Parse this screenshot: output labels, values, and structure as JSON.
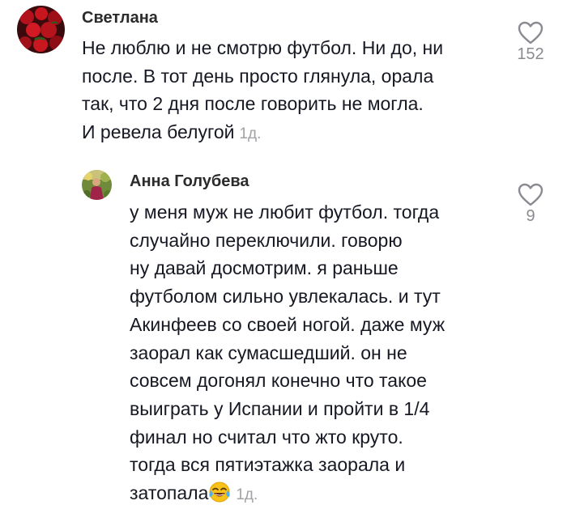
{
  "comments": [
    {
      "username": "Светлана",
      "avatar_icon": "roses-photo-avatar",
      "lines": [
        "Не люблю и не смотрю футбол. Ни до, ни",
        "после. В тот день просто глянула, орала",
        "так, что 2 дня после говорить не могла.",
        "И ревела белугой"
      ],
      "timestamp": "1д.",
      "like_icon": "heart-outline-icon",
      "likes": "152"
    },
    {
      "username": "Анна Голубева",
      "avatar_icon": "garden-photo-avatar",
      "lines": [
        "у меня муж не любит футбол. тогда",
        "случайно переключили. говорю",
        "ну давай досмотрим. я раньше",
        "футболом сильно увлекалась. и тут",
        "Акинфеев со своей ногой. даже муж",
        "заорал как сумасшедший. он не",
        "совсем догонял конечно что такое",
        "выиграть у Испании и пройти в 1/4",
        "финал но считал что жто круто.",
        "тогда вся пятиэтажка заорала и",
        "затопала"
      ],
      "emoji": "face-with-tears-of-joy",
      "timestamp": "1д.",
      "like_icon": "heart-outline-icon",
      "likes": "9"
    }
  ],
  "colors": {
    "text": "#161823",
    "username": "#2b2b2b",
    "timestamp": "#a2a2a6",
    "like_count": "#8a8b91",
    "heart_stroke": "#8a8b91"
  }
}
